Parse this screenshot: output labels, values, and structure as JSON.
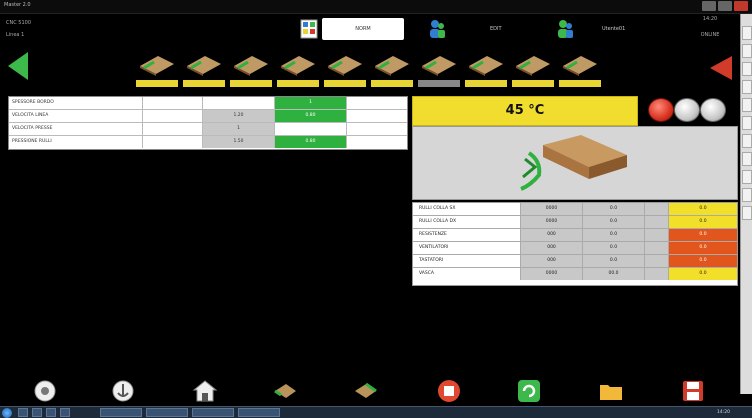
{
  "titlebar": {
    "app_title": "Master 2.0"
  },
  "header": {
    "left_line1": "CNC 5100",
    "left_line2": "Linea 1",
    "mode_label": "NORM",
    "center_label": "EDIT",
    "user_label": "Utente01",
    "right_line1": "14:20",
    "right_line2": "ONLINE"
  },
  "machine_strip": {
    "items": [
      {
        "icon": "edgebander-unit-icon",
        "active": true
      },
      {
        "icon": "edgebander-unit-icon",
        "active": true
      },
      {
        "icon": "edgebander-unit-icon",
        "active": true
      },
      {
        "icon": "edgebander-unit-icon",
        "active": true
      },
      {
        "icon": "edgebander-unit-icon",
        "active": true
      },
      {
        "icon": "edgebander-unit-icon",
        "active": true
      },
      {
        "icon": "edgebander-unit-icon",
        "active": false
      },
      {
        "icon": "edgebander-unit-icon",
        "active": true
      },
      {
        "icon": "edgebander-unit-icon",
        "active": true
      },
      {
        "icon": "edgebander-unit-icon",
        "active": true
      }
    ]
  },
  "param_table": {
    "rows": [
      [
        "SPESSORE BORDO",
        "",
        "",
        "1",
        ""
      ],
      [
        "VELOCITA LINEA",
        "",
        "1.20",
        "0.80",
        ""
      ],
      [
        "VELOCITA PRESSE",
        "",
        "1",
        "",
        ""
      ],
      [
        "PRESSIONE RULLI",
        "",
        "1.50",
        "0.80",
        ""
      ]
    ]
  },
  "temperature": {
    "value": "45 °C"
  },
  "status_table": {
    "rows": [
      {
        "label": "RULLI COLLA SX",
        "c1": "0000",
        "c2": "0.0",
        "c3": "0.0",
        "c3_color": "yellow"
      },
      {
        "label": "RULLI COLLA DX",
        "c1": "0000",
        "c2": "0.0",
        "c3": "0.0",
        "c3_color": "yellow"
      },
      {
        "label": "RESISTENZE",
        "c1": "000",
        "c2": "0.0",
        "c3": "0.0",
        "c3_color": "orange"
      },
      {
        "label": "VENTILATORI",
        "c1": "000",
        "c2": "0.0",
        "c3": "0.0",
        "c3_color": "orange"
      },
      {
        "label": "TASTATORI",
        "c1": "000",
        "c2": "0.0",
        "c3": "0.0",
        "c3_color": "orange"
      },
      {
        "label": "VASCA",
        "c1": "0000",
        "c2": "00.0",
        "c3": "0.0",
        "c3_color": "yellow"
      }
    ]
  },
  "bottom_toolbar": {
    "buttons": [
      {
        "icon": "settings-icon"
      },
      {
        "icon": "anchor-icon"
      },
      {
        "icon": "home-icon"
      },
      {
        "icon": "panel-left-icon"
      },
      {
        "icon": "panel-right-icon"
      },
      {
        "icon": "stop-icon"
      },
      {
        "icon": "refresh-icon"
      },
      {
        "icon": "folder-icon"
      },
      {
        "icon": "save-icon"
      }
    ]
  },
  "taskbar": {
    "clock": "14:20"
  },
  "colors": {
    "accent_green": "#2fb13f",
    "accent_yellow": "#f0dd2e",
    "accent_red": "#d23a2a",
    "accent_orange": "#e2551c"
  }
}
